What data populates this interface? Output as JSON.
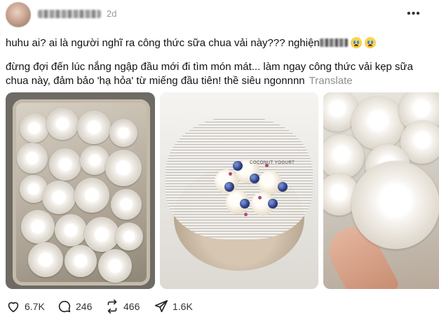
{
  "post": {
    "timestamp": "2d",
    "text_line1": "huhu ai? ai là người nghĩ ra công thức sữa chua vải này??? nghiện",
    "text_line2": "đừng đợi đến lúc nắng ngập đầu mới đi tìm món mát... làm ngay công thức vải kẹp sữa chua này, đảm bảo 'hạ hỏa' từ miếng đầu tiên! thề siêu ngonnnn",
    "translate_label": "Translate",
    "cup_label_text": "COCONUT YOGURT"
  },
  "actions": {
    "likes": "6.7K",
    "comments": "246",
    "reposts": "466",
    "shares": "1.6K"
  },
  "icons": [
    "more-icon",
    "heart-icon",
    "comment-icon",
    "repost-icon",
    "share-icon",
    "crying-emoji-icon"
  ]
}
